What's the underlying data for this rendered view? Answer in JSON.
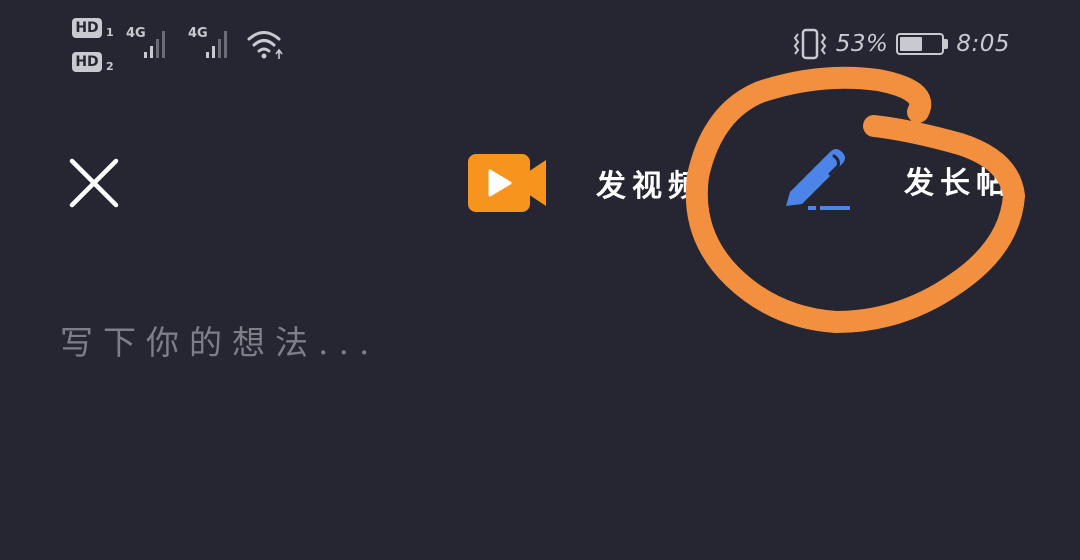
{
  "status_bar": {
    "sim1_badge": "HD",
    "sim1_index": "1",
    "sim2_badge": "HD",
    "sim2_index": "2",
    "network1": "4G",
    "network2": "4G",
    "battery_percent": "53%",
    "battery_level": 0.53,
    "time": "8:05",
    "icons": [
      "vibrate-icon",
      "wifi-icon",
      "battery-icon",
      "signal-icon"
    ]
  },
  "toolbar": {
    "close_icon": "close-icon",
    "actions": [
      {
        "label": "发视频",
        "icon": "video-camera-icon",
        "icon_color": "#f7941d"
      },
      {
        "label": "发长帖",
        "icon": "pen-icon",
        "icon_color": "#4c84e8"
      }
    ]
  },
  "composer": {
    "placeholder": "写下你的想法..."
  },
  "colors": {
    "background": "#252631",
    "annotation": "#f39040"
  }
}
